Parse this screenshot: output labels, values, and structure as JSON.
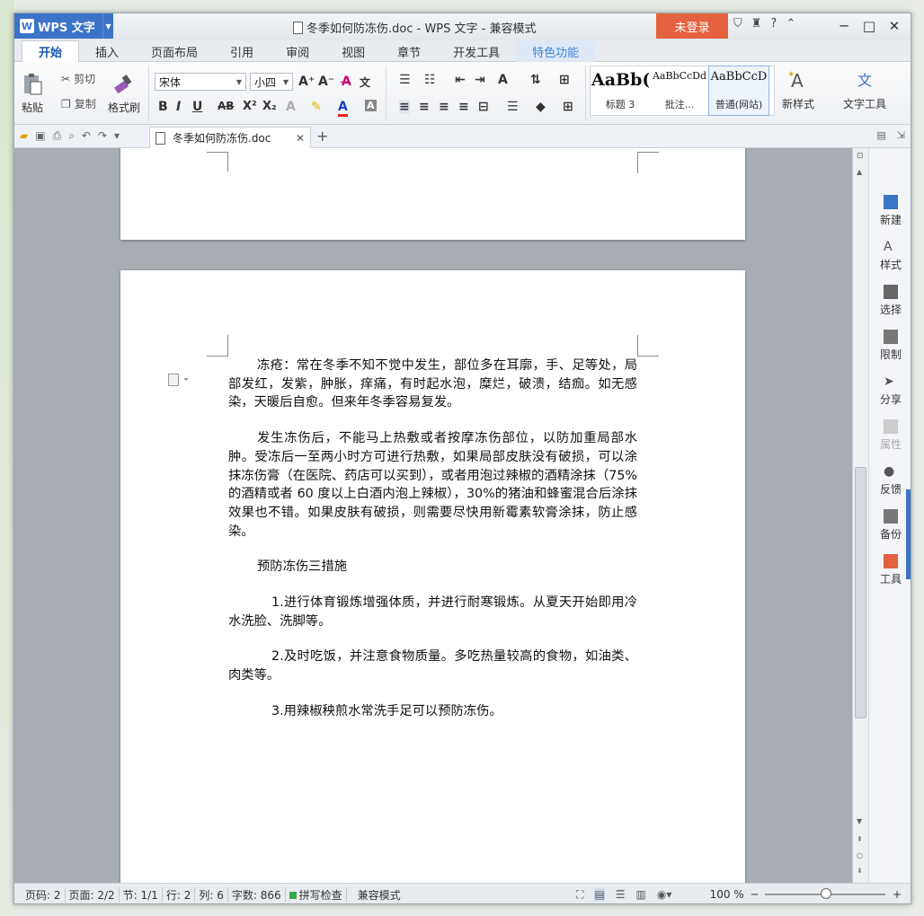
{
  "app": {
    "name": "WPS 文字",
    "logo": "W",
    "doc_title": "冬季如何防冻伤.doc - WPS 文字 - 兼容模式",
    "login": "未登录"
  },
  "titlebar_icons": [
    "⛉",
    "♜",
    "?",
    "⌃"
  ],
  "tabs": [
    "开始",
    "插入",
    "页面布局",
    "引用",
    "审阅",
    "视图",
    "章节",
    "开发工具",
    "特色功能"
  ],
  "ribbon": {
    "paste": "粘贴",
    "cut": "剪切",
    "copy": "复制",
    "format_painter": "格式刷",
    "font": "宋体",
    "font_size": "小四",
    "styles": [
      {
        "sample": "AaBb(",
        "label": "标题 3"
      },
      {
        "sample": "AaBbCcDd",
        "label": "批注..."
      },
      {
        "sample": "AaBbCcD",
        "label": "普通(网站)"
      }
    ],
    "new_style": "新样式",
    "text_tools": "文字工具"
  },
  "doc_tab": "冬季如何防冻伤.doc",
  "document": {
    "paragraphs": [
      {
        "cls": "pi",
        "text": "冻疮：常在冬季不知不觉中发生，部位多在耳廓，手、足等处，局部发红，发紫，肿胀，痒痛，有时起水泡，糜烂，破溃，结痂。如无感染，天暖后自愈。但来年冬季容易复发。"
      },
      {
        "cls": "pi",
        "text": "发生冻伤后，不能马上热敷或者按摩冻伤部位，以防加重局部水肿。受冻后一至两小时方可进行热敷，如果局部皮肤没有破损，可以涂抹冻伤膏（在医院、药店可以买到），或者用泡过辣椒的酒精涂抹（75%的酒精或者 60 度以上白酒内泡上辣椒），30%的猪油和蜂蜜混合后涂抹效果也不错。如果皮肤有破损，则需要尽快用新霉素软膏涂抹，防止感染。"
      },
      {
        "cls": "pi",
        "text": "预防冻伤三措施"
      },
      {
        "cls": "pi2",
        "text": "1.进行体育锻炼增强体质，并进行耐寒锻炼。从夏天开始即用冷水洗脸、洗脚等。"
      },
      {
        "cls": "pi2",
        "text": "2.及时吃饭，并注意食物质量。多吃热量较高的食物，如油类、肉类等。"
      },
      {
        "cls": "pi2",
        "text": "3.用辣椒秧煎水常洗手足可以预防冻伤。"
      }
    ]
  },
  "side_panel": [
    "新建",
    "样式",
    "选择",
    "限制",
    "分享",
    "属性",
    "反馈",
    "备份",
    "工具"
  ],
  "status": {
    "page_no": "页码: 2",
    "pages": "页面: 2/2",
    "section": "节: 1/1",
    "row": "行: 2",
    "col": "列: 6",
    "words": "字数: 866",
    "spell": "拼写检查",
    "mode": "兼容模式",
    "zoom": "100 %",
    "zoom_level": 1.0
  }
}
